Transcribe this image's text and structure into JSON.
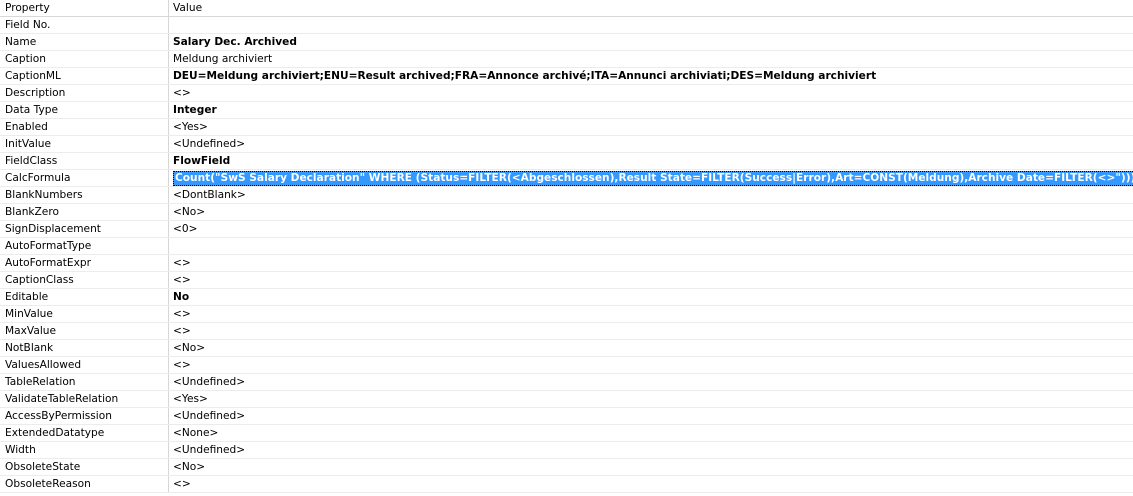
{
  "header": {
    "property": "Property",
    "value": "Value"
  },
  "rows": [
    {
      "property": "Field No.",
      "value": ""
    },
    {
      "property": "Name",
      "value": "Salary Dec. Archived",
      "bold": true
    },
    {
      "property": "Caption",
      "value": "Meldung archiviert"
    },
    {
      "property": "CaptionML",
      "value": "DEU=Meldung archiviert;ENU=Result archived;FRA=Annonce archivé;ITA=Annunci archiviati;DES=Meldung archiviert",
      "bold": true
    },
    {
      "property": "Description",
      "value": "<>"
    },
    {
      "property": "Data Type",
      "value": "Integer",
      "bold": true
    },
    {
      "property": "Enabled",
      "value": "<Yes>"
    },
    {
      "property": "InitValue",
      "value": "<Undefined>"
    },
    {
      "property": "FieldClass",
      "value": "FlowField",
      "bold": true
    },
    {
      "property": "CalcFormula",
      "value": "Count(\"SwS Salary Declaration\" WHERE (Status=FILTER(<Abgeschlossen),Result State=FILTER(Success|Error),Art=CONST(Meldung),Archive Date=FILTER(<>\")))",
      "selected": true
    },
    {
      "property": "BlankNumbers",
      "value": "<DontBlank>"
    },
    {
      "property": "BlankZero",
      "value": "<No>"
    },
    {
      "property": "SignDisplacement",
      "value": "<0>"
    },
    {
      "property": "AutoFormatType",
      "value": ""
    },
    {
      "property": "AutoFormatExpr",
      "value": "<>"
    },
    {
      "property": "CaptionClass",
      "value": "<>"
    },
    {
      "property": "Editable",
      "value": "No",
      "bold": true
    },
    {
      "property": "MinValue",
      "value": "<>"
    },
    {
      "property": "MaxValue",
      "value": "<>"
    },
    {
      "property": "NotBlank",
      "value": "<No>"
    },
    {
      "property": "ValuesAllowed",
      "value": "<>"
    },
    {
      "property": "TableRelation",
      "value": "<Undefined>"
    },
    {
      "property": "ValidateTableRelation",
      "value": "<Yes>"
    },
    {
      "property": "AccessByPermission",
      "value": "<Undefined>"
    },
    {
      "property": "ExtendedDatatype",
      "value": "<None>"
    },
    {
      "property": "Width",
      "value": "<Undefined>"
    },
    {
      "property": "ObsoleteState",
      "value": "<No>"
    },
    {
      "property": "ObsoleteReason",
      "value": "<>"
    }
  ],
  "colors": {
    "selection": "#3399ff",
    "grid_line": "#ececec"
  }
}
